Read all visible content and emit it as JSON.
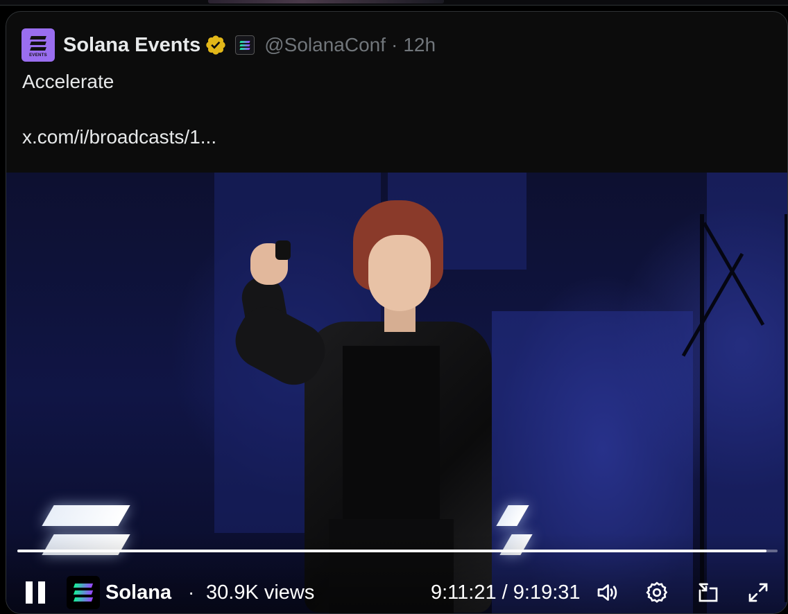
{
  "post": {
    "display_name": "Solana Events",
    "avatar_caption": "EVENTS",
    "handle": "@SolanaConf",
    "separator": "·",
    "time": "12h",
    "text": "Accelerate",
    "link": "x.com/i/broadcasts/1..."
  },
  "player": {
    "channel_name": "Solana",
    "separator": "·",
    "views": "30.9K views",
    "timecode": "9:11:21 / 9:19:31",
    "progress": 0.985
  },
  "colors": {
    "background": "#000000",
    "card": "#0c0c0c",
    "verified_gold": "#e2b719",
    "avatar_purple": "#9a6ef0",
    "muted_text": "#71767b"
  },
  "icons": {
    "verified": "verified-badge-icon",
    "affiliate": "solana-affiliate-icon",
    "pause": "pause-icon",
    "volume": "volume-icon",
    "settings": "gear-icon",
    "pip": "picture-in-picture-icon",
    "fullscreen": "fullscreen-icon"
  }
}
